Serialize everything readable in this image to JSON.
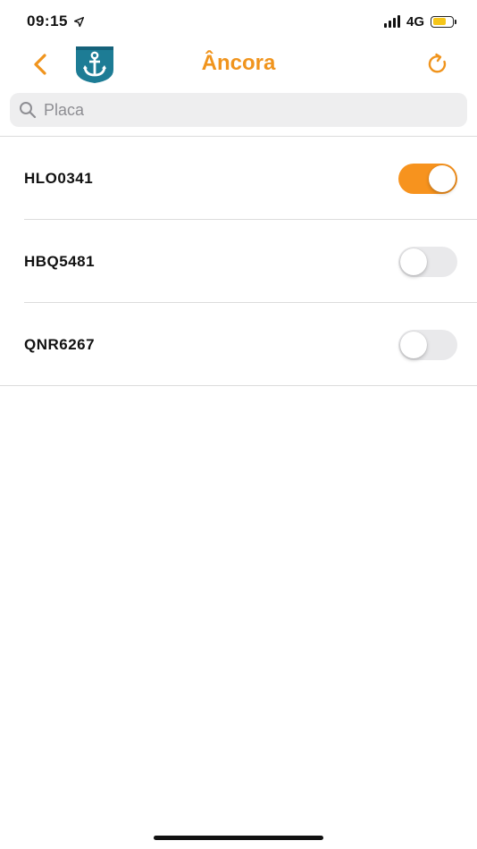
{
  "status_bar": {
    "time": "09:15",
    "network": "4G",
    "location_icon": "location-arrow-icon",
    "battery_level": 0.7,
    "battery_color": "#f5c518"
  },
  "nav": {
    "title": "Âncora",
    "back_icon": "chevron-left-icon",
    "logo_icon": "anchor-shield-icon",
    "refresh_icon": "refresh-icon",
    "accent_color": "#f0941d"
  },
  "search": {
    "placeholder": "Placa",
    "value": "",
    "icon": "search-icon"
  },
  "vehicles": [
    {
      "plate": "HLO0341",
      "anchored": true
    },
    {
      "plate": "HBQ5481",
      "anchored": false
    },
    {
      "plate": "QNR6267",
      "anchored": false
    }
  ]
}
